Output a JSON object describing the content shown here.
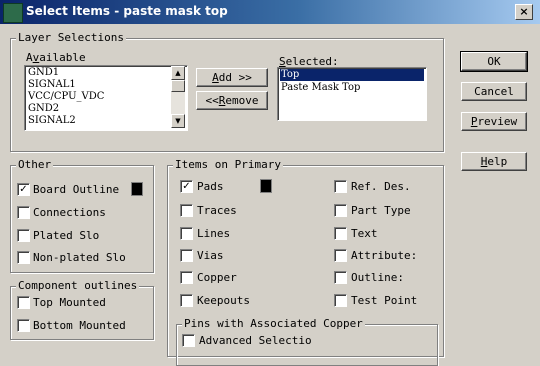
{
  "window": {
    "title": "Select Items - paste mask top",
    "close_glyph": "×"
  },
  "layer_selections": {
    "legend": "Layer Selections",
    "available_label": "Available",
    "available_items": [
      "GND1",
      "SIGNAL1",
      "VCC/CPU_VDC",
      "GND2",
      "SIGNAL2"
    ],
    "selected_label": "Selected:",
    "selected_items": [
      "Top",
      "Paste Mask Top"
    ],
    "add_label": "Add >>",
    "remove_label": "<<Remove"
  },
  "buttons": {
    "ok": "OK",
    "cancel": "Cancel",
    "preview": "Preview",
    "help": "Help"
  },
  "other": {
    "legend": "Other",
    "items": [
      {
        "label": "Board Outline",
        "checked": true
      },
      {
        "label": "Connections",
        "checked": false
      },
      {
        "label": "Plated Slo",
        "checked": false
      },
      {
        "label": "Non-plated Slo",
        "checked": false
      }
    ]
  },
  "component_outlines": {
    "legend": "Component outlines",
    "items": [
      {
        "label": "Top Mounted",
        "checked": false
      },
      {
        "label": "Bottom Mounted",
        "checked": false
      }
    ]
  },
  "items_on_primary": {
    "legend": "Items on Primary",
    "left": [
      {
        "label": "Pads",
        "checked": true
      },
      {
        "label": "Traces",
        "checked": false
      },
      {
        "label": "Lines",
        "checked": false
      },
      {
        "label": "Vias",
        "checked": false
      },
      {
        "label": "Copper",
        "checked": false
      },
      {
        "label": "Keepouts",
        "checked": false
      }
    ],
    "right": [
      {
        "label": "Ref. Des.",
        "checked": false
      },
      {
        "label": "Part Type",
        "checked": false
      },
      {
        "label": "Text",
        "checked": false
      },
      {
        "label": "Attribute:",
        "checked": false
      },
      {
        "label": "Outline:",
        "checked": false
      },
      {
        "label": "Test Point",
        "checked": false
      }
    ]
  },
  "pins": {
    "legend": "Pins with Associated Copper",
    "items": [
      {
        "label": "Advanced Selectio",
        "checked": false
      }
    ]
  },
  "check_glyph": "✓",
  "colors": {
    "titlebar_start": "#0a246a",
    "titlebar_end": "#a6caf0",
    "face": "#d4d0c8",
    "selection": "#0a246a",
    "swatch": "#000000"
  }
}
